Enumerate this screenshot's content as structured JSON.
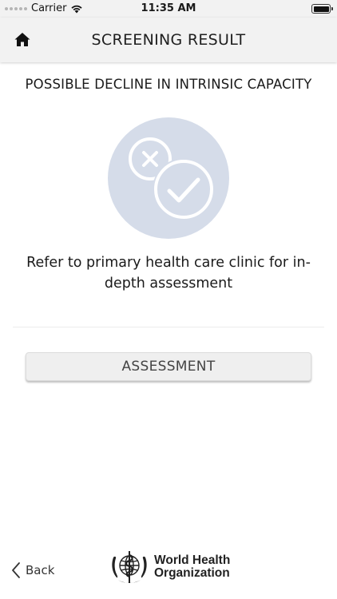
{
  "status_bar": {
    "carrier": "Carrier",
    "time": "11:35 AM",
    "battery_level": 1.0
  },
  "nav": {
    "title": "SCREENING RESULT",
    "home_icon": "home-icon"
  },
  "result": {
    "title": "POSSIBLE DECLINE IN INTRINSIC CAPACITY",
    "icon": "cross-check-circle-icon",
    "message": "Refer to primary health care clinic for in-depth assessment"
  },
  "actions": {
    "assessment_label": "ASSESSMENT"
  },
  "footer": {
    "back_label": "Back",
    "logo_line1": "World Health",
    "logo_line2": "Organization"
  },
  "colors": {
    "icon_circle": "#d5dce9",
    "bar_background": "#f2f2f2",
    "button_background": "#efefef"
  }
}
